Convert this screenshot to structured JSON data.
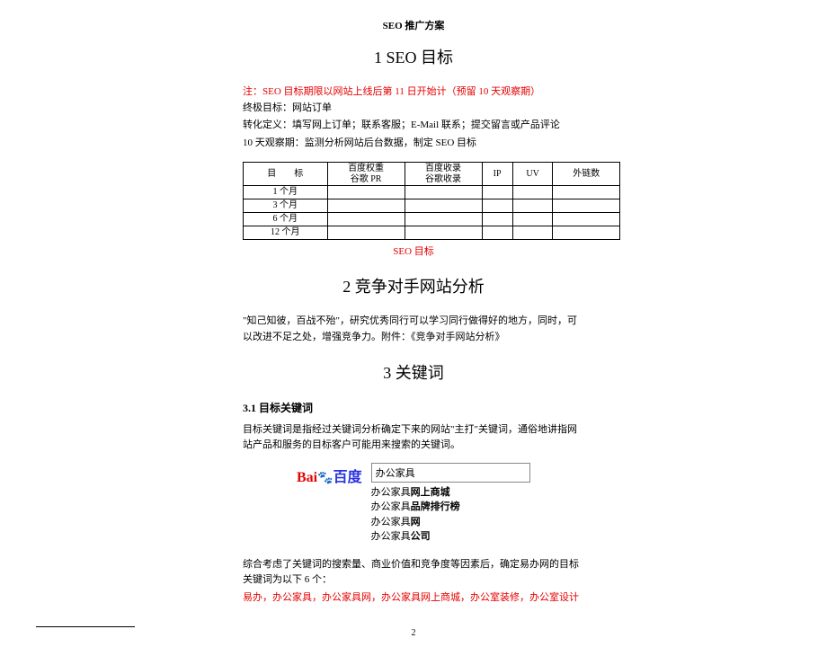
{
  "header": "SEO 推广方案",
  "section1": {
    "title": "1 SEO 目标",
    "note": "注：SEO 目标期限以网站上线后第 11 日开始计（预留 10 天观察期）",
    "line1": "终极目标：网站订单",
    "line2": "转化定义：填写网上订单；联系客服；E-Mail 联系；提交留言或产品评论",
    "line3": "10 天观察期：监测分析网站后台数据，制定 SEO 目标",
    "table": {
      "headers": [
        "目　　标",
        "百度权重\n谷歌 PR",
        "百度收录\n谷歌收录",
        "IP",
        "UV",
        "外链数"
      ],
      "rows": [
        "1 个月",
        "3 个月",
        "6 个月",
        "12 个月"
      ],
      "caption": "SEO 目标"
    }
  },
  "section2": {
    "title": "2 竞争对手网站分析",
    "body": "\"知己知彼，百战不殆\"，研究优秀同行可以学习同行做得好的地方，同时，可以改进不足之处，增强竞争力。附件：《竞争对手网站分析》"
  },
  "section3": {
    "title": "3 关键词",
    "sub1_title": "3.1 目标关键词",
    "sub1_body": "目标关键词是指经过关键词分析确定下来的网站\"主打\"关键词，通俗地讲指网站产品和服务的目标客户可能用来搜索的关键词。",
    "search_query": "办公家具",
    "suggestions": [
      {
        "prefix": "办公家具",
        "bold": "网上商城"
      },
      {
        "prefix": "办公家具",
        "bold": "品牌排行榜"
      },
      {
        "prefix": "办公家具",
        "bold": "网"
      },
      {
        "prefix": "办公家具",
        "bold": "公司"
      }
    ],
    "conclusion": "综合考虑了关键词的搜索量、商业价值和竞争度等因素后，确定易办网的目标关键词为以下 6 个：",
    "keywords": "易办，办公家具，办公家具网，办公家具网上商城，办公室装修，办公室设计"
  },
  "baidu_logo": {
    "bai": "Bai",
    "paw": "㿟",
    "du": "百度"
  },
  "page_number": "2"
}
